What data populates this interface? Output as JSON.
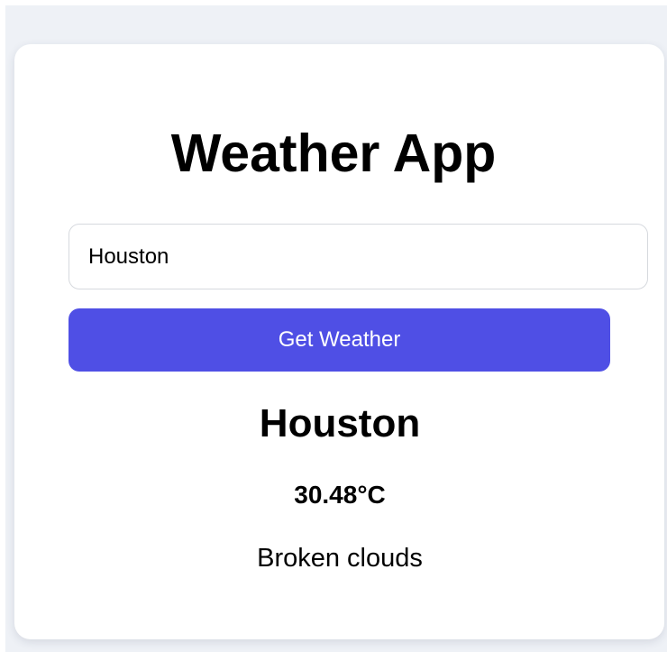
{
  "app": {
    "title": "Weather App"
  },
  "search": {
    "value": "Houston",
    "button_label": "Get Weather"
  },
  "result": {
    "city": "Houston",
    "temperature": "30.48°C",
    "description": "Broken clouds"
  },
  "colors": {
    "page_background": "#eef1f6",
    "card_background": "#ffffff",
    "button_background": "#4f4fe5",
    "button_text": "#ffffff",
    "input_border": "#d6d9de"
  }
}
